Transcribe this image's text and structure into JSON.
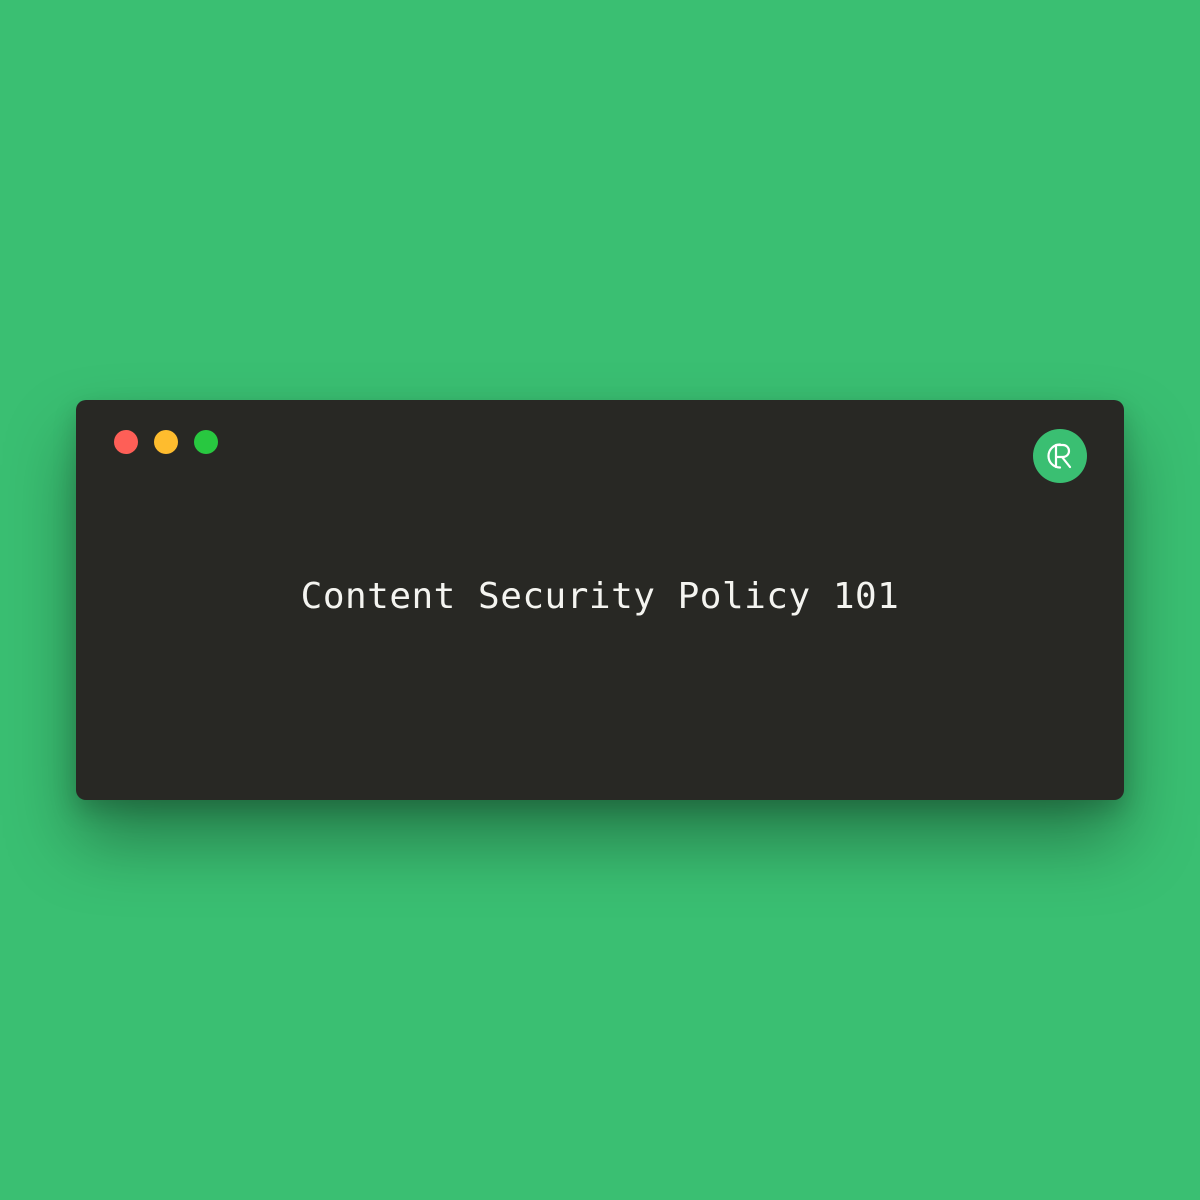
{
  "window": {
    "title": "Content Security Policy 101",
    "controls": [
      "close",
      "minimize",
      "maximize"
    ],
    "logo_text": "CR"
  },
  "colors": {
    "background": "#3abf72",
    "window": "#282824",
    "text": "#f4f4f0",
    "close": "#fe5f57",
    "minimize": "#febc2e",
    "maximize": "#28c840",
    "logo_bg": "#3abf72"
  }
}
